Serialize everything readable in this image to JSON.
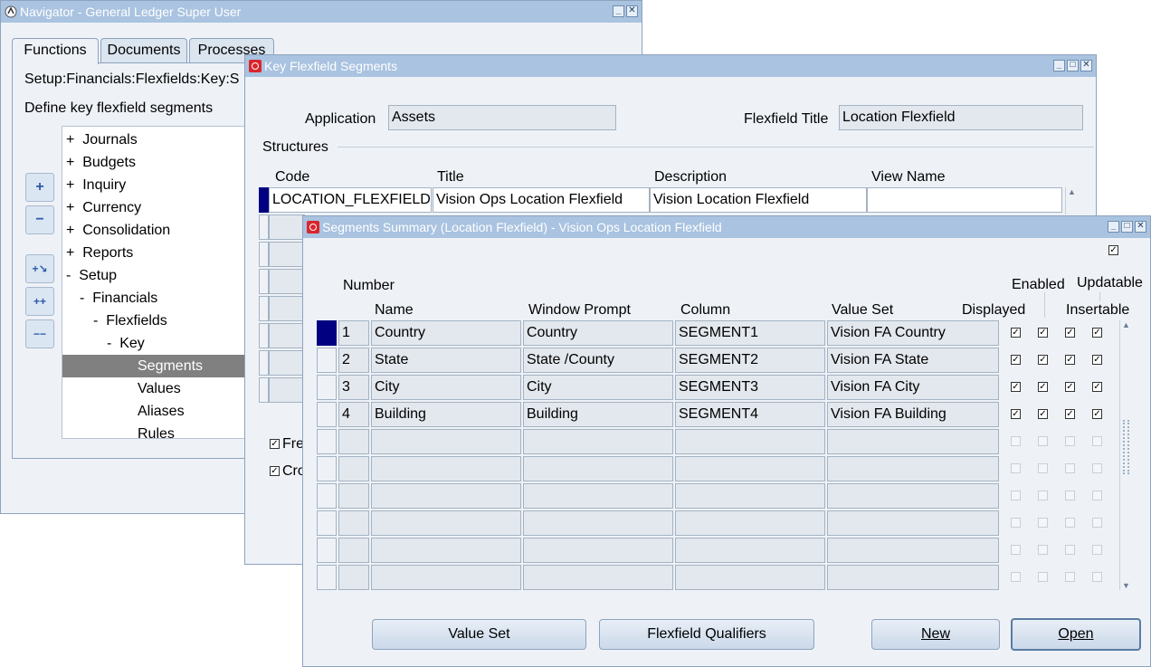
{
  "navigator": {
    "title": "Navigator - General Ledger Super User",
    "tabs": [
      "Functions",
      "Documents",
      "Processes"
    ],
    "path": "Setup:Financials:Flexfields:Key:S",
    "description": "Define key flexfield segments",
    "tree": [
      {
        "prefix": "+",
        "label": "Journals"
      },
      {
        "prefix": "+",
        "label": "Budgets"
      },
      {
        "prefix": "+",
        "label": "Inquiry"
      },
      {
        "prefix": "+",
        "label": "Currency"
      },
      {
        "prefix": "+",
        "label": "Consolidation"
      },
      {
        "prefix": "+",
        "label": "Reports"
      },
      {
        "prefix": "-",
        "label": "Setup"
      },
      {
        "prefix": "-",
        "label": "Financials"
      },
      {
        "prefix": "-",
        "label": "Flexfields"
      },
      {
        "prefix": "-",
        "label": "Key"
      },
      {
        "prefix": "",
        "label": "Segments"
      },
      {
        "prefix": "",
        "label": "Values"
      },
      {
        "prefix": "",
        "label": "Aliases"
      },
      {
        "prefix": "",
        "label": "Rules"
      }
    ],
    "side_buttons": [
      "+",
      "−",
      "+↘",
      "++",
      "−−"
    ]
  },
  "kfs": {
    "title": "Key Flexfield Segments",
    "application_label": "Application",
    "application_value": "Assets",
    "flexfield_title_label": "Flexfield Title",
    "flexfield_title_value": "Location Flexfield",
    "structures_label": "Structures",
    "columns": [
      "Code",
      "Title",
      "Description",
      "View Name"
    ],
    "row": {
      "code": "LOCATION_FLEXFIELD",
      "title": "Vision Ops Location Flexfield",
      "description": "Vision Location Flexfield",
      "view_name": ""
    },
    "checkbox_1": "Fre",
    "checkbox_2": "Cro"
  },
  "summary": {
    "title": "Segments Summary (Location Flexfield) - Vision Ops Location Flexfield",
    "headers": {
      "number": "Number",
      "name": "Name",
      "window_prompt": "Window Prompt",
      "column": "Column",
      "value_set": "Value Set",
      "displayed": "Displayed",
      "enabled": "Enabled",
      "updatable": "Updatable",
      "insertable": "Insertable"
    },
    "rows": [
      {
        "number": "1",
        "name": "Country",
        "prompt": "Country",
        "column": "SEGMENT1",
        "value_set": "Vision FA Country"
      },
      {
        "number": "2",
        "name": "State",
        "prompt": "State /County",
        "column": "SEGMENT2",
        "value_set": "Vision FA State"
      },
      {
        "number": "3",
        "name": "City",
        "prompt": "City",
        "column": "SEGMENT3",
        "value_set": "Vision FA City"
      },
      {
        "number": "4",
        "name": "Building",
        "prompt": "Building",
        "column": "SEGMENT4",
        "value_set": "Vision FA Building"
      }
    ],
    "buttons": {
      "value_set": "Value Set",
      "flexfield_qualifiers": "Flexfield Qualifiers",
      "new": "New",
      "open": "Open"
    }
  }
}
